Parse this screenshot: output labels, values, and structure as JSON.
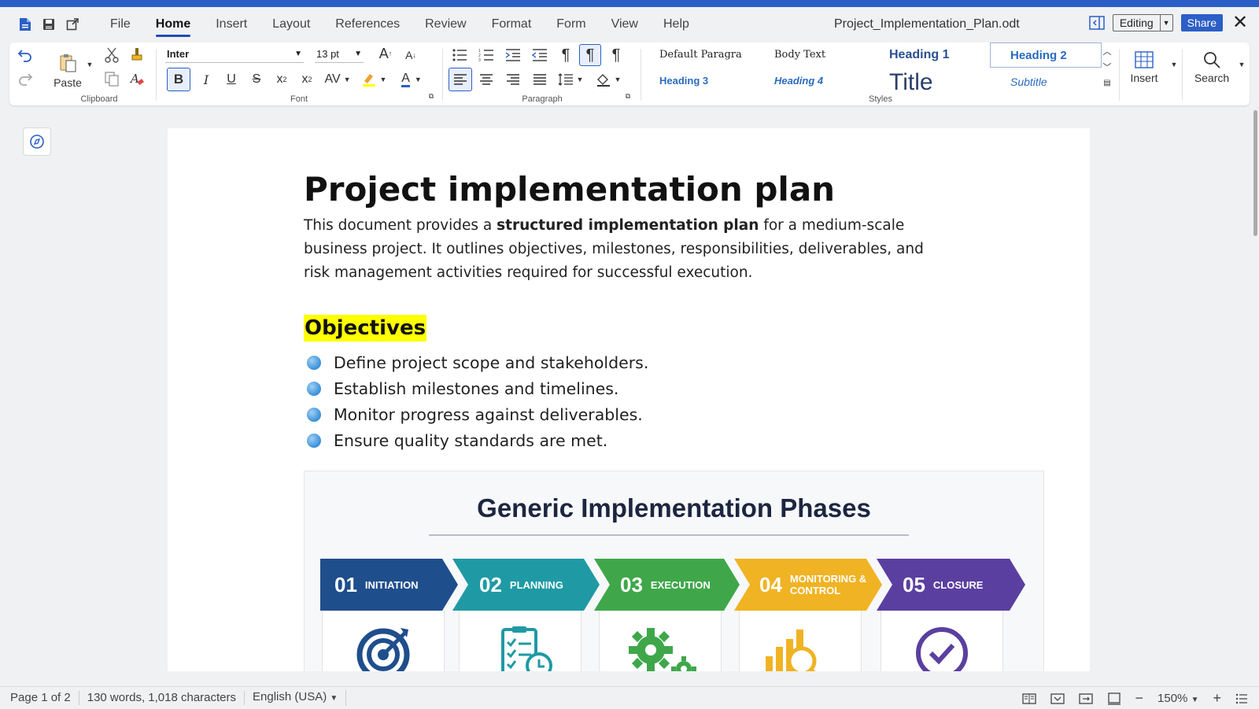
{
  "menubar": {
    "items": [
      "File",
      "Home",
      "Insert",
      "Layout",
      "References",
      "Review",
      "Format",
      "Form",
      "View",
      "Help"
    ],
    "active": "Home",
    "document_title": "Project_Implementation_Plan.odt",
    "editing_label": "Editing",
    "share_label": "Share"
  },
  "ribbon": {
    "clipboard": {
      "paste_label": "Paste",
      "group_label": "Clipboard"
    },
    "font": {
      "family": "Inter",
      "size": "13 pt",
      "group_label": "Font"
    },
    "paragraph": {
      "group_label": "Paragraph"
    },
    "styles": {
      "group_label": "Styles",
      "default_paragraph": "Default Paragra",
      "body_text": "Body Text",
      "heading1": "Heading 1",
      "heading2": "Heading 2",
      "heading3": "Heading 3",
      "heading4": "Heading 4",
      "title": "Title",
      "subtitle": "Subtitle"
    },
    "insert_label": "Insert",
    "search_label": "Search"
  },
  "document": {
    "title": "Project implementation plan",
    "intro_before": "This document provides a ",
    "intro_bold": "structured implementation plan",
    "intro_after": " for a medium-scale business project. It outlines objectives, milestones, responsibilities, deliverables, and risk management activities required for successful execution.",
    "objectives_heading": "Objectives",
    "objectives": [
      "Define project scope and stakeholders.",
      "Establish milestones and timelines.",
      "Monitor progress against deliverables.",
      "Ensure quality standards are met."
    ],
    "infographic": {
      "title": "Generic Implementation Phases",
      "phases": [
        {
          "num": "01",
          "name": "INITIATION",
          "color": "#1f4e8c"
        },
        {
          "num": "02",
          "name": "PLANNING",
          "color": "#1f9aa5"
        },
        {
          "num": "03",
          "name": "EXECUTION",
          "color": "#3fa74a"
        },
        {
          "num": "04",
          "name": "MONITORING & CONTROL",
          "color": "#f0b323"
        },
        {
          "num": "05",
          "name": "CLOSURE",
          "color": "#5b3fa0"
        }
      ]
    }
  },
  "statusbar": {
    "page": "Page 1 of 2",
    "counts": "130 words, 1,018 characters",
    "language": "English (USA)",
    "zoom": "150%"
  }
}
